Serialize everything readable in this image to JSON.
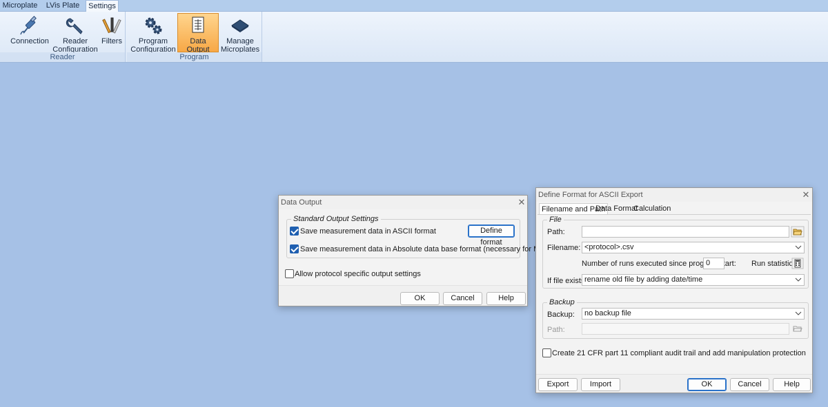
{
  "ribbon": {
    "tabs": [
      "Microplate",
      "LVis Plate",
      "Settings"
    ],
    "active_tab": "Settings",
    "groups": {
      "reader": {
        "label": "Reader",
        "buttons": {
          "connection": "Connection",
          "reader_config_line1": "Reader",
          "reader_config_line2": "Configuration",
          "filters": "Filters"
        }
      },
      "program": {
        "label": "Program",
        "buttons": {
          "program_config_line1": "Program",
          "program_config_line2": "Configuration",
          "data_output_line1": "Data",
          "data_output_line2": "Output",
          "manage_line1": "Manage",
          "manage_line2": "Microplates"
        }
      }
    }
  },
  "data_output_dialog": {
    "title": "Data Output",
    "section_label": "Standard Output Settings",
    "ascii_label": "Save measurement data in ASCII format",
    "ascii_checked": true,
    "define_format": "Define format",
    "absolute_label": "Save measurement data in Absolute data base format (necessary for MARS)",
    "absolute_checked": true,
    "protocol_label": "Allow protocol specific output settings",
    "protocol_checked": false,
    "ok": "OK",
    "cancel": "Cancel",
    "help": "Help"
  },
  "ascii_dialog": {
    "title": "Define Format for ASCII Export",
    "tabs": [
      "Filename and Path",
      "Data Format",
      "Calculation"
    ],
    "active_tab": "Filename and Path",
    "file_section": "File",
    "path_label": "Path:",
    "path_value": "",
    "filename_label": "Filename:",
    "filename_value": "<protocol>.csv",
    "runs_label": "Number of runs executed since program start:",
    "runs_value": "0",
    "run_stats_label": "Run statistics:",
    "if_exists_label": "If file exists:",
    "if_exists_value": "rename old file by adding date/time",
    "backup_section": "Backup",
    "backup_label": "Backup:",
    "backup_value": "no backup file",
    "backup_path_label": "Path:",
    "backup_path_value": "",
    "cfr_label": "Create 21 CFR part 11 compliant audit trail and add manipulation protection",
    "cfr_checked": false,
    "export": "Export",
    "import": "Import",
    "ok": "OK",
    "cancel": "Cancel",
    "help": "Help"
  },
  "colors": {
    "background": "#a6c1e6",
    "active_ribbon_button": "#f7a846",
    "checkbox_checked": "#1f5fb0"
  }
}
